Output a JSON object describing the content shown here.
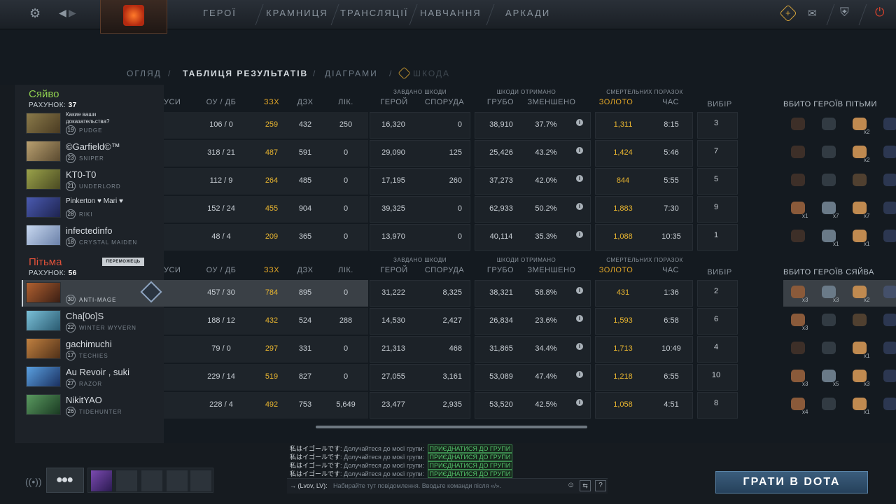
{
  "topbar": {
    "nav": [
      "ГЕРОЇ",
      "КРАМНИЦЯ",
      "ТРАНСЛЯЦІЇ",
      "НАВЧАННЯ",
      "АРКАДИ"
    ],
    "icons": [
      "gear-icon",
      "back-arrow-icon",
      "forward-arrow-icon",
      "dota-logo",
      "plus-icon",
      "mail-icon",
      "armory-icon",
      "power-icon"
    ]
  },
  "tabs": [
    "ОГЛЯД",
    "ТАБЛИЦЯ РЕЗУЛЬТАТІВ",
    "ДІАГРАМИ",
    "ШКОДА"
  ],
  "columns": {
    "partial_first": "УСИ",
    "kd": "ОУ / ДБ",
    "gpm": "ЗЗХ",
    "xpm": "ДЗХ",
    "heal": "ЛІК.",
    "dealt_group": "ЗАВДАНО ШКОДИ",
    "dealt_heroes": "ГЕРОЙ",
    "dealt_buildings": "СПОРУДА",
    "recv_group": "ШКОДИ ОТРИМАНО",
    "recv_raw": "ГРУБО",
    "recv_reduced": "ЗМЕНШЕНО",
    "death_group": "СМЕРТЕЛЬНИХ ПОРАЗОК",
    "death_gold": "ЗОЛОТО",
    "death_time": "ЧАС",
    "pick": "ВИБІР"
  },
  "radiant": {
    "name": "Сяйво",
    "score_label": "РАХУНОК:",
    "score": "37",
    "kills_heading": "ВБИТО ГЕРОЇВ ПІТЬМИ",
    "players": [
      {
        "name": "Какие ваши доказательства?",
        "level": "19",
        "hero": "PUDGE",
        "kd": "106 / 0",
        "gpm": "259",
        "xpm": "432",
        "heal": "250",
        "hero_dmg": "16,320",
        "bld_dmg": "0",
        "raw": "38,910",
        "reduced": "37.7%",
        "lost_gold": "1,311",
        "dead_time": "8:15",
        "pick": "3",
        "kills": [
          "",
          "",
          "x2",
          ""
        ]
      },
      {
        "name": "©Garfield©™",
        "level": "23",
        "hero": "SNIPER",
        "kd": "318 / 21",
        "gpm": "487",
        "xpm": "591",
        "heal": "0",
        "hero_dmg": "29,090",
        "bld_dmg": "125",
        "raw": "25,426",
        "reduced": "43.2%",
        "lost_gold": "1,424",
        "dead_time": "5:46",
        "pick": "7",
        "kills": [
          "",
          "",
          "x2",
          ""
        ]
      },
      {
        "name": "KT0-T0",
        "level": "21",
        "hero": "UNDERLORD",
        "kd": "112 / 9",
        "gpm": "264",
        "xpm": "485",
        "heal": "0",
        "hero_dmg": "17,195",
        "bld_dmg": "260",
        "raw": "37,273",
        "reduced": "42.0%",
        "lost_gold": "844",
        "dead_time": "5:55",
        "pick": "5",
        "kills": [
          "",
          "",
          "",
          ""
        ]
      },
      {
        "name": "Pinkerton ♥ Mari ♥",
        "level": "28",
        "hero": "RIKI",
        "kd": "152 / 24",
        "gpm": "455",
        "xpm": "904",
        "heal": "0",
        "hero_dmg": "39,325",
        "bld_dmg": "0",
        "raw": "62,933",
        "reduced": "50.2%",
        "lost_gold": "1,883",
        "dead_time": "7:30",
        "pick": "9",
        "kills": [
          "x1",
          "x7",
          "x7",
          ""
        ]
      },
      {
        "name": "infectedinfo",
        "level": "18",
        "hero": "CRYSTAL MAIDEN",
        "kd": "48 / 4",
        "gpm": "209",
        "xpm": "365",
        "heal": "0",
        "hero_dmg": "13,970",
        "bld_dmg": "0",
        "raw": "40,114",
        "reduced": "35.3%",
        "lost_gold": "1,088",
        "dead_time": "10:35",
        "pick": "1",
        "kills": [
          "",
          "x1",
          "x1",
          ""
        ]
      }
    ]
  },
  "dire": {
    "name": "Пітьма",
    "score_label": "РАХУНОК:",
    "score": "56",
    "winner_label": "ПЕРЕМОЖЕЦЬ",
    "kills_heading": "ВБИТО ГЕРОЇВ СЯЙВА",
    "players": [
      {
        "name": "",
        "level": "30",
        "hero": "ANTI-MAGE",
        "kd": "457 / 30",
        "gpm": "784",
        "xpm": "895",
        "heal": "0",
        "hero_dmg": "31,222",
        "bld_dmg": "8,325",
        "raw": "38,321",
        "reduced": "58.8%",
        "lost_gold": "431",
        "dead_time": "1:36",
        "pick": "2",
        "kills": [
          "x3",
          "x3",
          "x2",
          ""
        ]
      },
      {
        "name": "Cha[0o]S",
        "level": "22",
        "hero": "WINTER WYVERN",
        "kd": "188 / 12",
        "gpm": "432",
        "xpm": "524",
        "heal": "288",
        "hero_dmg": "14,530",
        "bld_dmg": "2,427",
        "raw": "26,834",
        "reduced": "23.6%",
        "lost_gold": "1,593",
        "dead_time": "6:58",
        "pick": "6",
        "kills": [
          "x3",
          "",
          "",
          ""
        ]
      },
      {
        "name": "gachimuchi",
        "level": "17",
        "hero": "TECHIES",
        "kd": "79 / 0",
        "gpm": "297",
        "xpm": "331",
        "heal": "0",
        "hero_dmg": "21,313",
        "bld_dmg": "468",
        "raw": "31,865",
        "reduced": "34.4%",
        "lost_gold": "1,713",
        "dead_time": "10:49",
        "pick": "4",
        "kills": [
          "",
          "",
          "x1",
          ""
        ]
      },
      {
        "name": "Au Revoir , suki",
        "level": "27",
        "hero": "RAZOR",
        "kd": "229 / 14",
        "gpm": "519",
        "xpm": "827",
        "heal": "0",
        "hero_dmg": "27,055",
        "bld_dmg": "3,161",
        "raw": "53,089",
        "reduced": "47.4%",
        "lost_gold": "1,218",
        "dead_time": "6:55",
        "pick": "10",
        "kills": [
          "x3",
          "x5",
          "x3",
          ""
        ]
      },
      {
        "name": "NikitYAO",
        "level": "26",
        "hero": "TIDEHUNTER",
        "kd": "228 / 4",
        "gpm": "492",
        "xpm": "753",
        "heal": "5,649",
        "hero_dmg": "23,477",
        "bld_dmg": "2,935",
        "raw": "53,520",
        "reduced": "42.5%",
        "lost_gold": "1,058",
        "dead_time": "4:51",
        "pick": "8",
        "kills": [
          "x4",
          "",
          "x1",
          ""
        ]
      }
    ]
  },
  "chat": {
    "speaker": "私はイゴールです",
    "message": ": Долучайтеся до моєї групи:",
    "join": "ПРИЄДНАТИСЯ ДО ГРУПИ",
    "channel": "→ (Lvov, LV):",
    "placeholder": "Набирайте тут повідомлення. Вводьте команди після «/».",
    "help": "?"
  },
  "play_button": "ГРАТИ В DOTA",
  "colors": {
    "radiant": "#8fcf4f",
    "dire": "#e0513a",
    "gold": "#e8b530"
  }
}
